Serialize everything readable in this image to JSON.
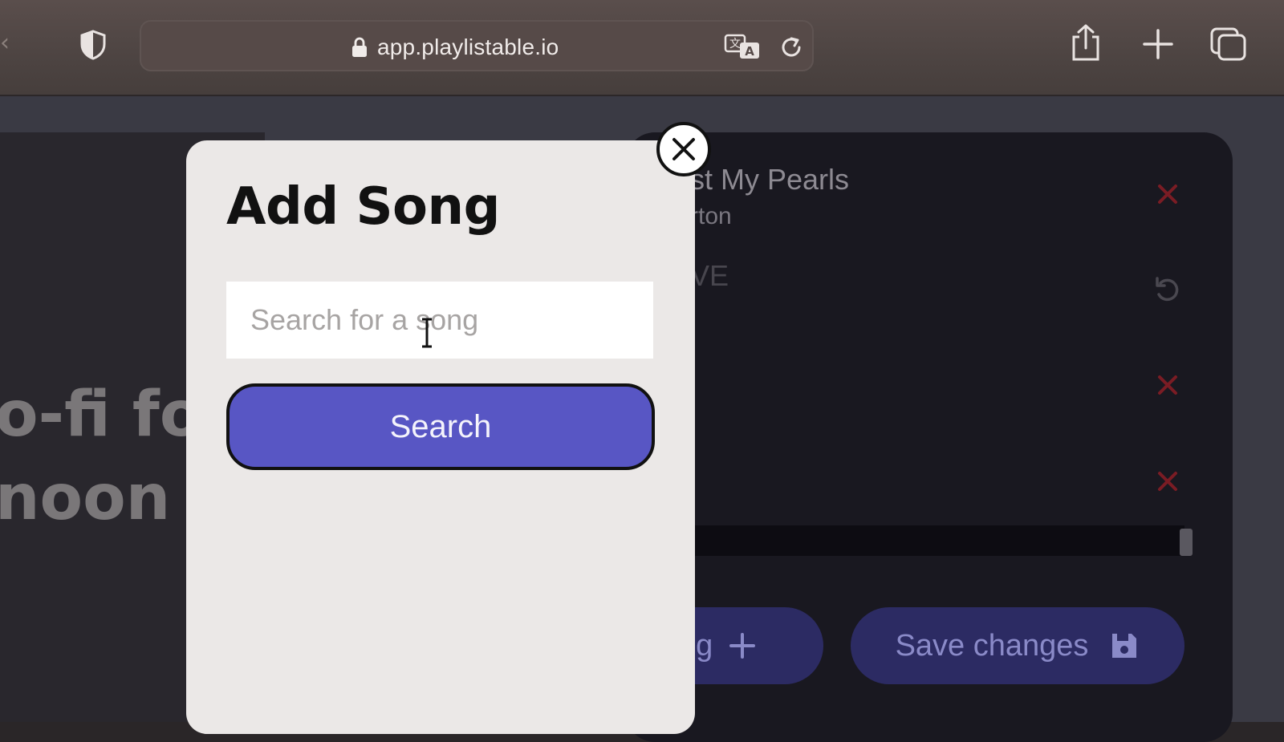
{
  "browser": {
    "url": "app.playlistable.io",
    "icons": {
      "back": "chevron-left-icon",
      "privacy": "shield-icon",
      "lock": "lock-icon",
      "translate": "translate-icon",
      "reload": "reload-icon",
      "share": "share-icon",
      "new_tab": "plus-icon",
      "tabs": "tabs-overview-icon"
    }
  },
  "background": {
    "playlist_title": "o-fi fo\nnoon",
    "songs": [
      {
        "title": "st My Pearls",
        "artist": "rton",
        "state": "active"
      },
      {
        "title": "VE",
        "state": "removed"
      }
    ],
    "add_song_label": "ng",
    "save_label": "Save changes",
    "colors": {
      "delete": "#7a1c24",
      "accent": "#2c2b63"
    }
  },
  "modal": {
    "title": "Add Song",
    "search_placeholder": "Search for a song",
    "search_value": "",
    "search_button": "Search",
    "close_icon": "close-icon",
    "colors": {
      "button": "#5856c4",
      "surface": "#ebe8e7"
    }
  }
}
